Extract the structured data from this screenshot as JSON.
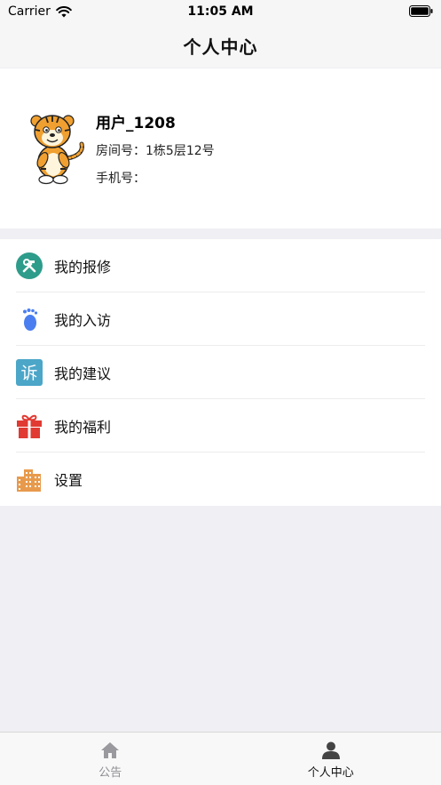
{
  "status_bar": {
    "carrier": "Carrier",
    "time": "11:05 AM"
  },
  "nav": {
    "title": "个人中心"
  },
  "profile": {
    "username": "用户_1208",
    "room": "房间号：1栋5层12号",
    "phone": "手机号："
  },
  "menu": {
    "items": [
      {
        "label": "我的报修",
        "icon": "wrench-hammer-icon",
        "color": "#2e9c8a"
      },
      {
        "label": "我的入访",
        "icon": "footprint-icon",
        "color": "#4a7ef0"
      },
      {
        "label": "我的建议",
        "icon": "complaint-icon",
        "color": "#4ba6c8",
        "glyph": "诉"
      },
      {
        "label": "我的福利",
        "icon": "gift-icon",
        "color": "#e03a32"
      },
      {
        "label": "设置",
        "icon": "buildings-icon",
        "color": "#e89a4c"
      }
    ]
  },
  "tab_bar": {
    "tabs": [
      {
        "label": "公告",
        "icon": "home-icon",
        "active": false
      },
      {
        "label": "个人中心",
        "icon": "person-icon",
        "active": true
      }
    ]
  }
}
